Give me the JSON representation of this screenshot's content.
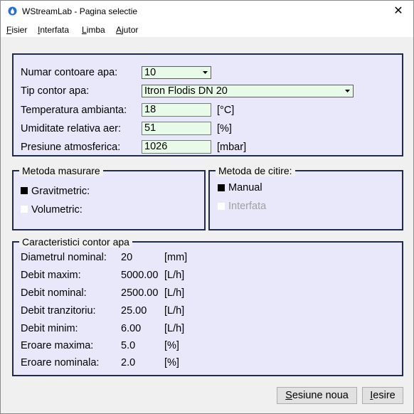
{
  "window": {
    "title": "WStreamLab - Pagina selectie",
    "close_glyph": "✕"
  },
  "menu": {
    "items": [
      {
        "accel": "F",
        "rest": "isier"
      },
      {
        "accel": "I",
        "rest": "nterfata"
      },
      {
        "accel": "L",
        "rest": "imba"
      },
      {
        "accel": "A",
        "rest": "jutor"
      }
    ]
  },
  "params": {
    "meter_count_label": "Numar contoare apa:",
    "meter_count_value": "10",
    "meter_type_label": "Tip contor apa:",
    "meter_type_value": "Itron Flodis DN 20",
    "temp_label": "Temperatura ambianta:",
    "temp_value": "18",
    "temp_unit": "[°C]",
    "humidity_label": "Umiditate relativa aer:",
    "humidity_value": "51",
    "humidity_unit": "[%]",
    "pressure_label": "Presiune atmosferica:",
    "pressure_value": "1026",
    "pressure_unit": "[mbar]"
  },
  "method": {
    "title": "Metoda masurare",
    "options": [
      {
        "label": "Gravitmetric:",
        "selected": true
      },
      {
        "label": "Volumetric:",
        "selected": false
      }
    ]
  },
  "reading": {
    "title": "Metoda de citire:",
    "options": [
      {
        "label": "Manual",
        "selected": true,
        "enabled": true
      },
      {
        "label": "Interfata",
        "selected": false,
        "enabled": false
      }
    ]
  },
  "characteristics": {
    "title": "Caracteristici contor apa",
    "rows": [
      {
        "label": "Diametrul nominal:",
        "value": "20",
        "unit": "[mm]"
      },
      {
        "label": "Debit maxim:",
        "value": "5000.00",
        "unit": "[L/h]"
      },
      {
        "label": "Debit nominal:",
        "value": "2500.00",
        "unit": "[L/h]"
      },
      {
        "label": "Debit tranzitoriu:",
        "value": "25.00",
        "unit": "[L/h]"
      },
      {
        "label": "Debit minim:",
        "value": "6.00",
        "unit": "[L/h]"
      },
      {
        "label": "Eroare maxima:",
        "value": "5.0",
        "unit": "[%]"
      },
      {
        "label": "Eroare nominala:",
        "value": "2.0",
        "unit": "[%]"
      }
    ]
  },
  "buttons": {
    "new_session": {
      "accel": "S",
      "rest": "esiune noua"
    },
    "exit": {
      "accel": "I",
      "rest": "esire"
    }
  },
  "colors": {
    "panel_background": "#e8e8fa",
    "panel_border": "#1f2a4c",
    "field_background": "#e8fbe8"
  }
}
